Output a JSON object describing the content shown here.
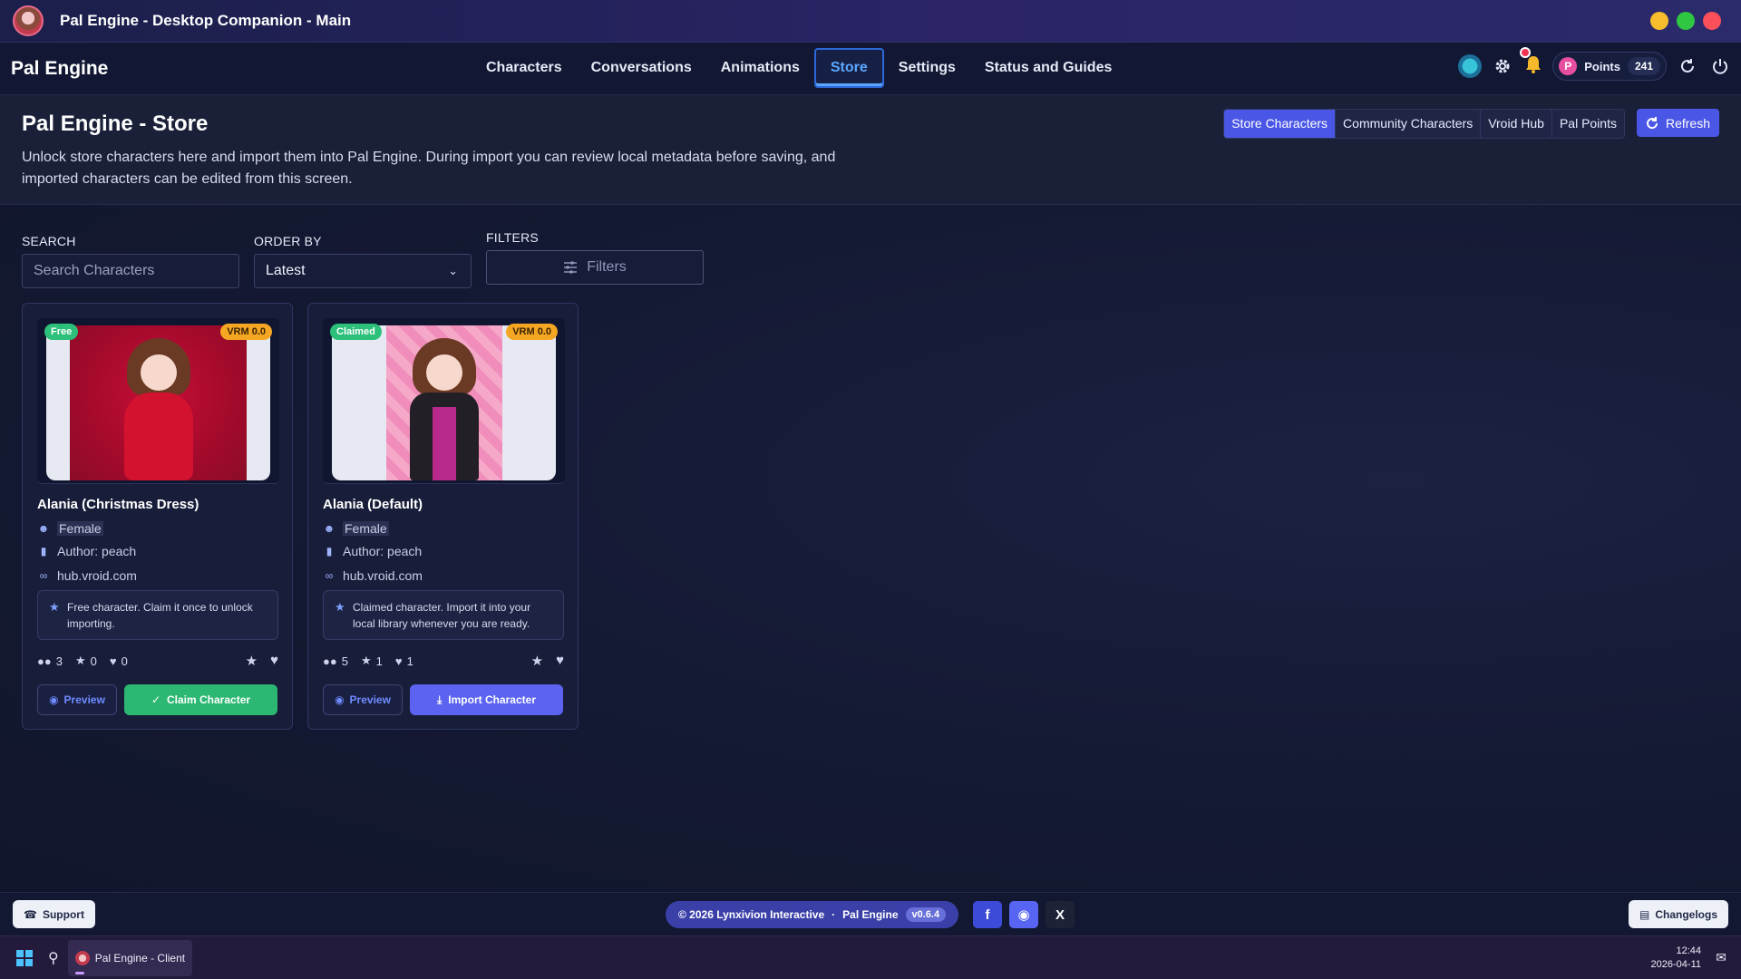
{
  "window": {
    "title": "Pal Engine - Desktop Companion - Main"
  },
  "nav": {
    "brand": "Pal Engine",
    "links": [
      "Characters",
      "Conversations",
      "Animations",
      "Store",
      "Settings",
      "Status and Guides"
    ],
    "active": "Store",
    "points_label": "Points",
    "points_value": "241",
    "points_badge": "P"
  },
  "page": {
    "title": "Pal Engine - Store",
    "description": "Unlock store characters here and import them into Pal Engine. During import you can review local metadata before saving, and imported characters can be edited from this screen.",
    "tabs": [
      "Store Characters",
      "Community Characters",
      "Vroid Hub",
      "Pal Points"
    ],
    "active_tab": "Store Characters",
    "refresh_label": "Refresh"
  },
  "controls": {
    "search_label": "SEARCH",
    "search_placeholder": "Search Characters",
    "order_label": "ORDER BY",
    "order_value": "Latest",
    "filters_label": "FILTERS",
    "filters_button": "Filters"
  },
  "cards": [
    {
      "status": "Free",
      "vrm": "VRM 0.0",
      "name": "Alania (Christmas Dress)",
      "gender": "Female",
      "author": "Author: peach",
      "source": "hub.vroid.com",
      "note": "Free character. Claim it once to unlock importing.",
      "users": "3",
      "stars": "0",
      "likes": "0",
      "preview_label": "Preview",
      "action_label": "Claim Character"
    },
    {
      "status": "Claimed",
      "vrm": "VRM 0.0",
      "name": "Alania (Default)",
      "gender": "Female",
      "author": "Author: peach",
      "source": "hub.vroid.com",
      "note": "Claimed character. Import it into your local library whenever you are ready.",
      "users": "5",
      "stars": "1",
      "likes": "1",
      "preview_label": "Preview",
      "action_label": "Import Character"
    }
  ],
  "footer": {
    "support_label": "Support",
    "copyright": "© 2026 Lynxivion Interactive",
    "product": "Pal Engine",
    "version": "v0.6.4",
    "social": {
      "facebook": "f",
      "discord": "◉",
      "x": "X"
    },
    "changelog_label": "Changelogs"
  },
  "taskbar": {
    "app_label": "Pal Engine - Client",
    "time": "12:44",
    "date": "2026-04-11"
  },
  "colors": {
    "accent": "#4a57e6",
    "claim": "#2cb872",
    "free_badge": "#2cc07a",
    "vrm_badge": "#f5a623",
    "active_nav": "#5aa7ff"
  },
  "icons": {
    "gender": "user-icon",
    "author": "id-badge-icon",
    "source": "link-icon",
    "note": "star-icon",
    "users": "users-icon",
    "stars": "star-icon",
    "likes": "heart-icon"
  }
}
